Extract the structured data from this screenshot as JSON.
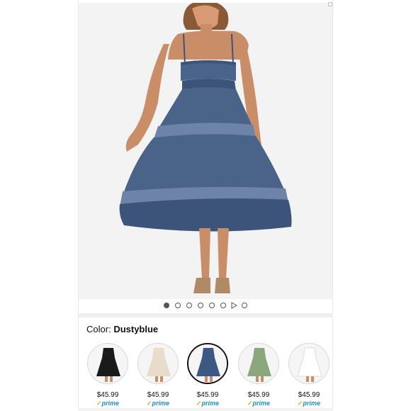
{
  "carousel": {
    "image_count": 7,
    "active_index": 0,
    "has_video": true
  },
  "color_selector": {
    "label": "Color:",
    "selected": "Dustyblue",
    "swatches": [
      {
        "name": "Black",
        "fill": "#1a1a1a",
        "price": "$45.99",
        "prime": "prime"
      },
      {
        "name": "Apricot",
        "fill": "#e8dccb",
        "price": "$45.99",
        "prime": "prime"
      },
      {
        "name": "Dustyblue",
        "fill": "#3e5885",
        "price": "$45.99",
        "prime": "prime"
      },
      {
        "name": "Green",
        "fill": "#8aa77e",
        "price": "$45.99",
        "prime": "prime"
      },
      {
        "name": "White",
        "fill": "#f4f4f4",
        "price": "$45.99",
        "prime": "prime"
      }
    ]
  },
  "colors": {
    "dress_main": "#4a6389",
    "dress_shadow": "#3d547a",
    "lace": "#6d84a8",
    "skin": "#c98d68",
    "hair": "#8a5a36",
    "prime_blue": "#1e8ec6",
    "prime_check": "#f5a623"
  }
}
